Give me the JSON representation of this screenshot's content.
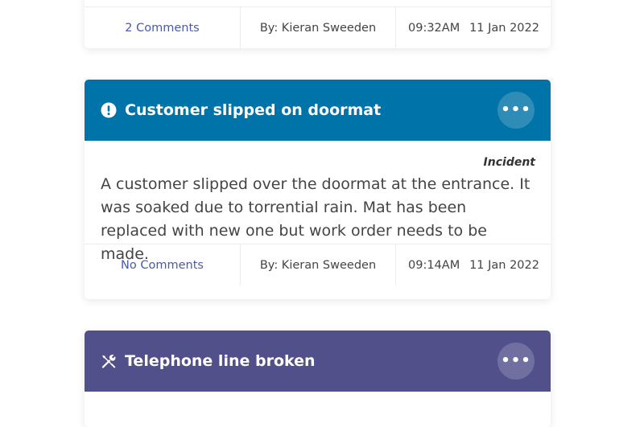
{
  "cards": [
    {
      "footer": {
        "comments": "2 Comments",
        "author": "By: Kieran Sweeden",
        "time": "09:32AM",
        "date": "11 Jan 2022"
      }
    },
    {
      "header_color": "#0073a8",
      "icon": "exclamation-circle-icon",
      "title": "Customer slipped on doormat",
      "more_label": "•••",
      "type": "Incident",
      "description": "A customer slipped over the doormat at the entrance. It was soaked due to torrential rain. Mat has been replaced with new one but work order needs to be made.",
      "footer": {
        "comments": "No Comments",
        "author": "By: Kieran Sweeden",
        "time": "09:14AM",
        "date": "11 Jan 2022"
      }
    },
    {
      "header_color": "#52508b",
      "icon": "tools-icon",
      "title": "Telephone line broken",
      "more_label": "•••"
    }
  ]
}
